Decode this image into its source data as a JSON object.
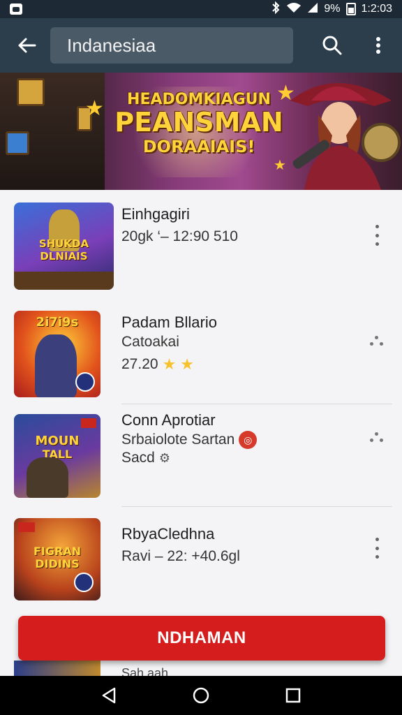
{
  "status_bar": {
    "battery_text": "9%",
    "time": "1:2:03"
  },
  "app_bar": {
    "search_text": "Indanesiaa"
  },
  "banner": {
    "line1": "HEADOMKIAGUN",
    "line2": "PEANSMAN",
    "line3": "DORAAIAIS!"
  },
  "items": [
    {
      "title": "Einhgagiri",
      "subtitle": "20gk ‘– 12:90 510",
      "thumb_text": [
        "SHUKDA",
        "DLNIAIS"
      ]
    },
    {
      "title": "Padam Bllario",
      "subtitle": "Catoakai",
      "meta": "27.20",
      "thumb_text": [
        "2i7i9s",
        ""
      ]
    },
    {
      "title": "Conn Aprotiar",
      "subtitle": "Srbaiolote Sartan",
      "meta": "Sacd",
      "thumb_text": [
        "MOUN",
        "TALL"
      ]
    },
    {
      "title": "RbyaCledhna",
      "subtitle": "Ravi – 22: +40.6gl",
      "thumb_text": [
        "FIGRAN",
        "DIDINS"
      ]
    }
  ],
  "cta": {
    "label": "NDHAMAN"
  },
  "peek": {
    "text": "Sah aah"
  },
  "colors": {
    "status_bar": "#1d2a36",
    "app_bar": "#2c3d4c",
    "search_box": "#4b5a67",
    "cta": "#d61d1d",
    "star": "#f6c12b"
  }
}
